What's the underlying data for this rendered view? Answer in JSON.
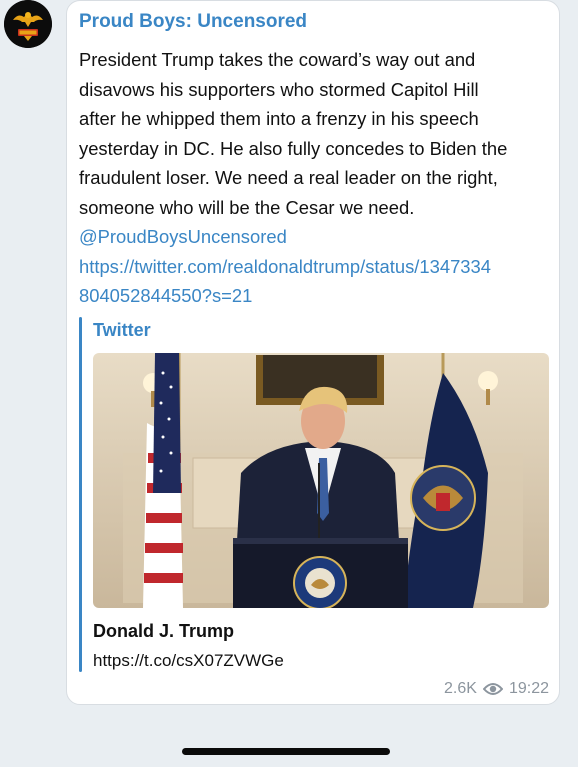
{
  "channel": {
    "name": "Proud Boys: Uncensored"
  },
  "message": {
    "lines": [
      "President Trump takes the coward’s way out and",
      "disavows his supporters who stormed Capitol Hill",
      "after he whipped them into a frenzy in his speech",
      "yesterday in DC. He also fully concedes to Biden the",
      "fraudulent loser. We need a real leader on the right,",
      "someone who will be the Cesar we need."
    ],
    "mention": "@ProudBoysUncensored",
    "link_line1": "https://twitter.com/realdonaldtrump/status/1347334",
    "link_line2": "804052844550?s=21"
  },
  "preview": {
    "site": "Twitter",
    "title": "Donald J. Trump",
    "url": "https://t.co/csX07ZVWGe",
    "image_icon": "trump-video-thumbnail"
  },
  "meta": {
    "views": "2.6K",
    "time": "19:22",
    "views_icon": "eye-icon"
  },
  "colors": {
    "link": "#3a86c5",
    "background": "#e9eef2",
    "bubble": "#ffffff"
  }
}
